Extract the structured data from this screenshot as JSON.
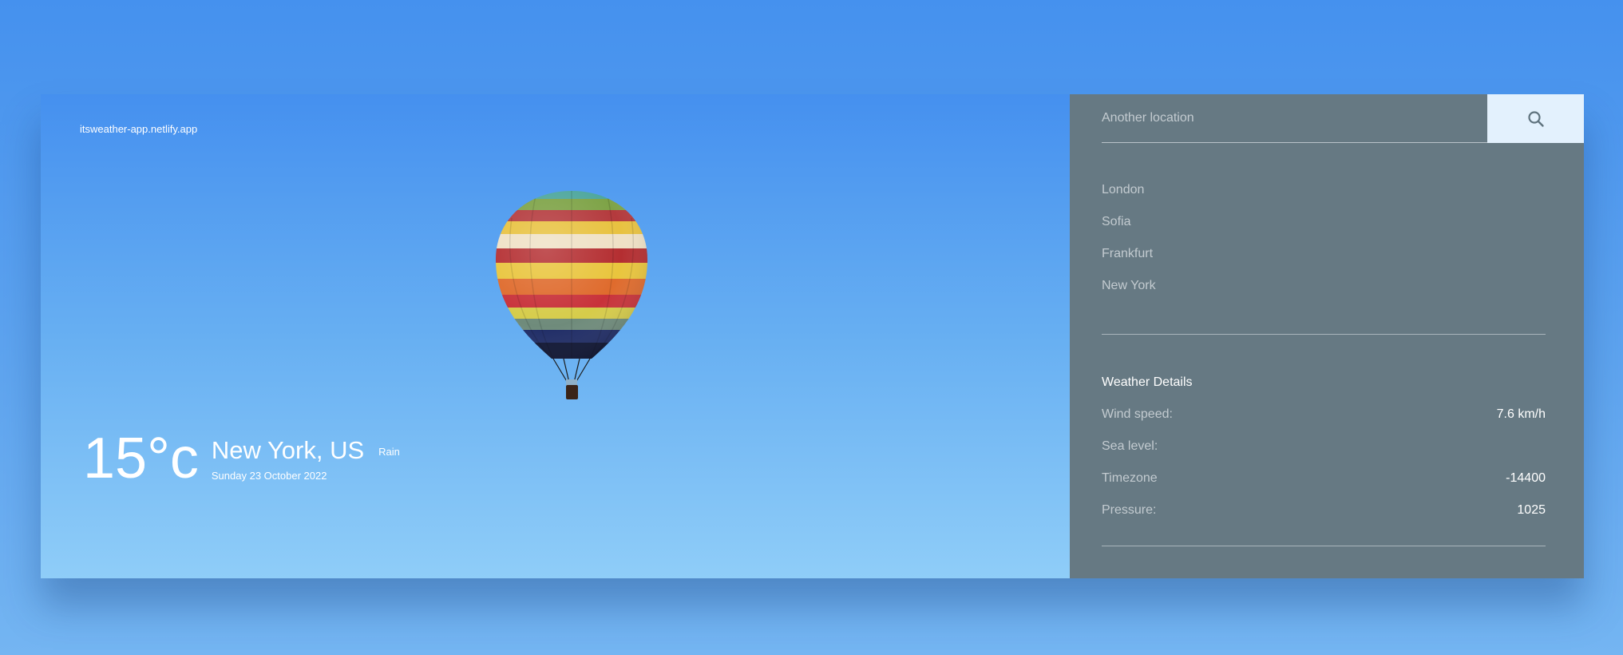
{
  "hero": {
    "url_label": "itsweather-app.netlify.app",
    "temperature": "15°c",
    "city": "New York, US",
    "date": "Sunday 23 October 2022",
    "condition": "Rain"
  },
  "search": {
    "placeholder": "Another location",
    "icon": "search-icon"
  },
  "cities": [
    {
      "label": "London"
    },
    {
      "label": "Sofia"
    },
    {
      "label": "Frankfurt"
    },
    {
      "label": "New York"
    }
  ],
  "details": {
    "title": "Weather Details",
    "rows": [
      {
        "label": "Wind speed:",
        "value": "7.6 km/h"
      },
      {
        "label": "Sea level:",
        "value": ""
      },
      {
        "label": "Timezone",
        "value": "-14400"
      },
      {
        "label": "Pressure:",
        "value": "1025"
      }
    ]
  },
  "colors": {
    "panel_bg": "#667983",
    "search_button_bg": "#e3f1fd",
    "sky_top": "#4590ef",
    "sky_bottom": "#8fcdf8"
  }
}
